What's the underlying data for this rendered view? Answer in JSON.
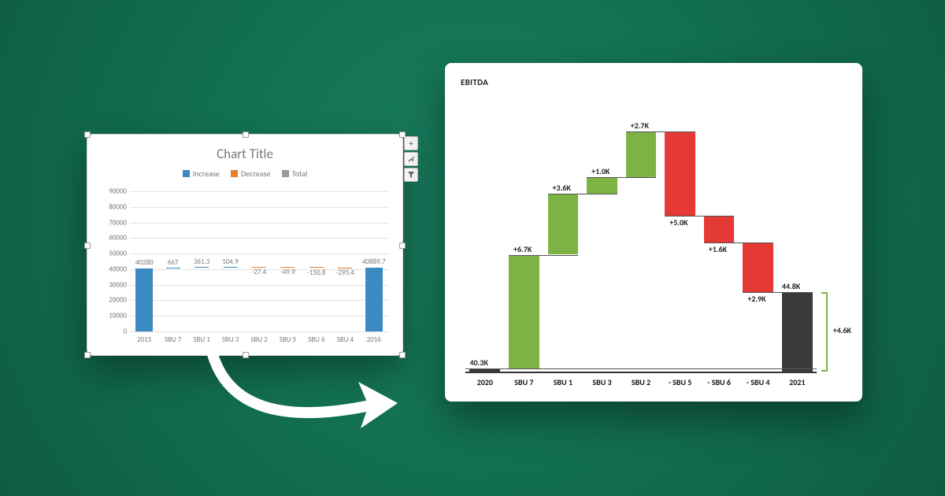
{
  "left": {
    "title": "Chart Title",
    "legend": {
      "increase": "Increase",
      "decrease": "Decrease",
      "total": "Total"
    },
    "yticks": [
      "0",
      "10000",
      "20000",
      "30000",
      "40000",
      "50000",
      "60000",
      "70000",
      "80000",
      "90000"
    ],
    "categories": [
      "2015",
      "SBU 7",
      "SBU 1",
      "SBU 3",
      "SBU 2",
      "SBU 5",
      "SBU 6",
      "SBU 4",
      "2016"
    ],
    "labels": [
      "40280",
      "667",
      "361.3",
      "104.9",
      "-27.4",
      "-49.9",
      "-150.8",
      "-295.4",
      "40889.7"
    ]
  },
  "right": {
    "title": "EBITDA",
    "categories": [
      "2020",
      "SBU 7",
      "SBU 1",
      "SBU 3",
      "SBU 2",
      "- SBU 5",
      "- SBU 6",
      "- SBU 4",
      "2021"
    ],
    "labels": [
      "40.3K",
      "+6.7K",
      "+3.6K",
      "+1.0K",
      "+2.7K",
      "+5.0K",
      "+1.6K",
      "+2.9K",
      "44.8K"
    ],
    "delta": "+4.6K"
  },
  "chart_data": [
    {
      "type": "bar",
      "title": "Chart Title",
      "categories": [
        "2015",
        "SBU 7",
        "SBU 1",
        "SBU 3",
        "SBU 2",
        "SBU 5",
        "SBU 6",
        "SBU 4",
        "2016"
      ],
      "values": [
        40280,
        667,
        361.3,
        104.9,
        -27.4,
        -49.9,
        -150.8,
        -295.4,
        40889.7
      ],
      "kind": [
        "total",
        "increase",
        "increase",
        "increase",
        "decrease",
        "decrease",
        "decrease",
        "decrease",
        "total"
      ],
      "ylim": [
        0,
        90000
      ],
      "ylabel": "",
      "xlabel": "",
      "legend": [
        "Increase",
        "Decrease",
        "Total"
      ]
    },
    {
      "type": "bar",
      "title": "EBITDA",
      "categories": [
        "2020",
        "SBU 7",
        "SBU 1",
        "SBU 3",
        "SBU 2",
        "- SBU 5",
        "- SBU 6",
        "- SBU 4",
        "2021"
      ],
      "values": [
        40300,
        6700,
        3600,
        1000,
        2700,
        -5000,
        -1600,
        -2900,
        44800
      ],
      "kind": [
        "total",
        "increase",
        "increase",
        "increase",
        "increase",
        "decrease",
        "decrease",
        "decrease",
        "total"
      ],
      "net_change": 4600,
      "ylabel": "",
      "xlabel": ""
    }
  ]
}
